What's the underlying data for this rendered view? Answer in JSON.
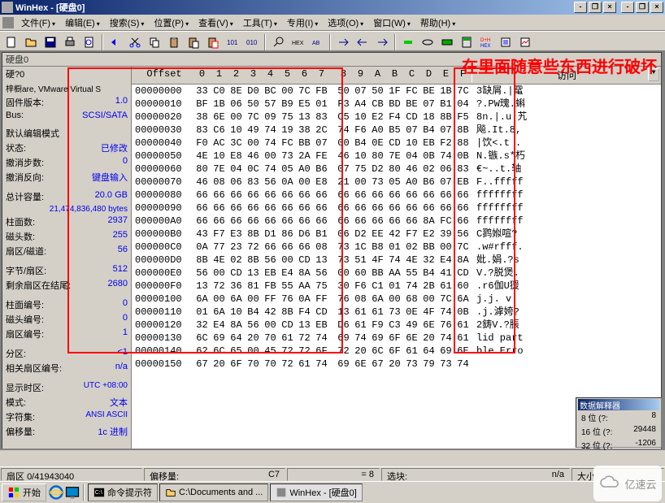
{
  "title": "WinHex - [硬盘0]",
  "menu": [
    "文件(F)",
    "编辑(E)",
    "搜索(S)",
    "位置(P)",
    "查看(V)",
    "工具(T)",
    "专用(I)",
    "选项(O)",
    "窗口(W)",
    "帮助(H)"
  ],
  "watermark": "在里面随意些东西进行破坏",
  "doc_title": "硬盘0",
  "sidebar": {
    "hardware": {
      "lbl": "硬?0",
      "val": ""
    },
    "model": {
      "lbl": "梓橱are, VMware Virtual S",
      "val": ""
    },
    "firmware": {
      "lbl": "固件版本:",
      "val": "1.0"
    },
    "bus": {
      "lbl": "Bus:",
      "val": "SCSI/SATA"
    },
    "edit_mode": {
      "lbl": "默认编辑模式",
      "val": ""
    },
    "status": {
      "lbl": "状态:",
      "val": "已修改"
    },
    "undo_steps": {
      "lbl": "撤消步数:",
      "val": "0"
    },
    "undo_dir": {
      "lbl": "撤消反向:",
      "val": "键盘输入"
    },
    "total": {
      "lbl": "总计容量:",
      "val": "20.0 GB"
    },
    "total_bytes": {
      "lbl": "",
      "val": "21,474,836,480 bytes"
    },
    "cylinders": {
      "lbl": "柱面数:",
      "val": "2937"
    },
    "heads": {
      "lbl": "磁头数:",
      "val": "255"
    },
    "sectors_track": {
      "lbl": "扇区/磁道:",
      "val": "56"
    },
    "bytes_sector": {
      "lbl": "字节/扇区:",
      "val": "512"
    },
    "remaining": {
      "lbl": "剩余扇区在结尾:",
      "val": "2680"
    },
    "col_no": {
      "lbl": "柱面编号:",
      "val": "0"
    },
    "head_no": {
      "lbl": "磁头编号:",
      "val": "0"
    },
    "sector_no": {
      "lbl": "扇区编号:",
      "val": "1"
    },
    "partition": {
      "lbl": "分区:",
      "val": "<1"
    },
    "rel_sector": {
      "lbl": "相关扇区编号:",
      "val": "n/a"
    },
    "timezone": {
      "lbl": "显示时区:",
      "val": "UTC +08:00"
    },
    "mode": {
      "lbl": "模式:",
      "val": "文本"
    },
    "charset": {
      "lbl": "字符集:",
      "val": "ANSI ASCII"
    },
    "last": {
      "lbl": "偏移量:",
      "val": "1c 进制"
    }
  },
  "hex": {
    "header_offset": "Offset",
    "header_bytes": [
      "0",
      "1",
      "2",
      "3",
      "4",
      "5",
      "6",
      "7",
      "8",
      "9",
      "A",
      "B",
      "C",
      "D",
      "E",
      "F"
    ],
    "header_ascii": "访问",
    "rows": [
      {
        "o": "00000000",
        "b": [
          "33",
          "C0",
          "8E",
          "D0",
          "BC",
          "00",
          "7C",
          "FB",
          "50",
          "07",
          "50",
          "1F",
          "FC",
          "BE",
          "1B",
          "7C"
        ],
        "a": "3缺屑.|鼋"
      },
      {
        "o": "00000010",
        "b": [
          "BF",
          "1B",
          "06",
          "50",
          "57",
          "B9",
          "E5",
          "01",
          "F3",
          "A4",
          "CB",
          "BD",
          "BE",
          "07",
          "B1",
          "04"
        ],
        "a": "?.PW瑰.蝌"
      },
      {
        "o": "00000020",
        "b": [
          "38",
          "6E",
          "00",
          "7C",
          "09",
          "75",
          "13",
          "83",
          "C5",
          "10",
          "E2",
          "F4",
          "CD",
          "18",
          "8B",
          "F5"
        ],
        "a": "8n.|.u.艽"
      },
      {
        "o": "00000030",
        "b": [
          "83",
          "C6",
          "10",
          "49",
          "74",
          "19",
          "38",
          "2C",
          "74",
          "F6",
          "A0",
          "B5",
          "07",
          "B4",
          "07",
          "8B"
        ],
        "a": "飚.It.8,"
      },
      {
        "o": "00000040",
        "b": [
          "F0",
          "AC",
          "3C",
          "00",
          "74",
          "FC",
          "BB",
          "07",
          "00",
          "B4",
          "0E",
          "CD",
          "10",
          "EB",
          "F2",
          "88"
        ],
        "a": "|饮<.t   ."
      },
      {
        "o": "00000050",
        "b": [
          "4E",
          "10",
          "E8",
          "46",
          "00",
          "73",
          "2A",
          "FE",
          "46",
          "10",
          "80",
          "7E",
          "04",
          "0B",
          "74",
          "0B"
        ],
        "a": "N.镞.s*朽"
      },
      {
        "o": "00000060",
        "b": [
          "80",
          "7E",
          "04",
          "0C",
          "74",
          "05",
          "A0",
          "B6",
          "07",
          "75",
          "D2",
          "80",
          "46",
          "02",
          "06",
          "83"
        ],
        "a": "€~..t.轴"
      },
      {
        "o": "00000070",
        "b": [
          "46",
          "08",
          "06",
          "83",
          "56",
          "0A",
          "00",
          "E8",
          "21",
          "00",
          "73",
          "05",
          "A0",
          "B6",
          "07",
          "EB"
        ],
        "a": "F..fffff"
      },
      {
        "o": "00000080",
        "b": [
          "66",
          "66",
          "66",
          "66",
          "66",
          "66",
          "66",
          "66",
          "66",
          "66",
          "66",
          "66",
          "66",
          "66",
          "66",
          "66"
        ],
        "a": "ffffffff"
      },
      {
        "o": "00000090",
        "b": [
          "66",
          "66",
          "66",
          "66",
          "66",
          "66",
          "66",
          "66",
          "66",
          "66",
          "66",
          "66",
          "66",
          "66",
          "66",
          "66"
        ],
        "a": "ffffffff"
      },
      {
        "o": "000000A0",
        "b": [
          "66",
          "66",
          "66",
          "66",
          "66",
          "66",
          "66",
          "66",
          "66",
          "66",
          "66",
          "66",
          "66",
          "8A",
          "FC",
          "66"
        ],
        "a": "ffffffff"
      },
      {
        "o": "000000B0",
        "b": [
          "43",
          "F7",
          "E3",
          "8B",
          "D1",
          "86",
          "D6",
          "B1",
          "06",
          "D2",
          "EE",
          "42",
          "F7",
          "E2",
          "39",
          "56"
        ],
        "a": "C鹨娰喧?"
      },
      {
        "o": "000000C0",
        "b": [
          "0A",
          "77",
          "23",
          "72",
          "66",
          "66",
          "66",
          "08",
          "73",
          "1C",
          "B8",
          "01",
          "02",
          "BB",
          "00",
          "7C"
        ],
        "a": ".w#rfff."
      },
      {
        "o": "000000D0",
        "b": [
          "8B",
          "4E",
          "02",
          "8B",
          "56",
          "00",
          "CD",
          "13",
          "73",
          "51",
          "4F",
          "74",
          "4E",
          "32",
          "E4",
          "8A"
        ],
        "a": "妣.娟.?s"
      },
      {
        "o": "000000E0",
        "b": [
          "56",
          "00",
          "CD",
          "13",
          "EB",
          "E4",
          "8A",
          "56",
          "00",
          "60",
          "BB",
          "AA",
          "55",
          "B4",
          "41",
          "CD"
        ],
        "a": "V.?脱煲."
      },
      {
        "o": "000000F0",
        "b": [
          "13",
          "72",
          "36",
          "81",
          "FB",
          "55",
          "AA",
          "75",
          "30",
          "F6",
          "C1",
          "01",
          "74",
          "2B",
          "61",
          "60"
        ],
        "a": ".r6伽U猨"
      },
      {
        "o": "00000100",
        "b": [
          "6A",
          "00",
          "6A",
          "00",
          "FF",
          "76",
          "0A",
          "FF",
          "76",
          "08",
          "6A",
          "00",
          "68",
          "00",
          "7C",
          "6A"
        ],
        "a": "j.j.  v."
      },
      {
        "o": "00000110",
        "b": [
          "01",
          "6A",
          "10",
          "B4",
          "42",
          "8B",
          "F4",
          "CD",
          "13",
          "61",
          "61",
          "73",
          "0E",
          "4F",
          "74",
          "0B"
        ],
        "a": ".j.滹姱?"
      },
      {
        "o": "00000120",
        "b": [
          "32",
          "E4",
          "8A",
          "56",
          "00",
          "CD",
          "13",
          "EB",
          "D6",
          "61",
          "F9",
          "C3",
          "49",
          "6E",
          "76",
          "61"
        ],
        "a": "2鋳V.?脹"
      },
      {
        "o": "00000130",
        "b": [
          "6C",
          "69",
          "64",
          "20",
          "70",
          "61",
          "72",
          "74",
          "69",
          "74",
          "69",
          "6F",
          "6E",
          "20",
          "74",
          "61"
        ],
        "a": "lid part"
      },
      {
        "o": "00000140",
        "b": [
          "62",
          "6C",
          "65",
          "00",
          "45",
          "72",
          "72",
          "6F",
          "72",
          "20",
          "6C",
          "6F",
          "61",
          "64",
          "69",
          "6E"
        ],
        "a": "ble Erro"
      },
      {
        "o": "00000150",
        "b": [
          "67",
          "20",
          "6F",
          "70",
          "70",
          "72",
          "61",
          "74",
          "69",
          "6E",
          "67",
          "20",
          "73",
          "79",
          "73",
          "74"
        ],
        "a": ""
      }
    ]
  },
  "status": {
    "sector": {
      "lbl": "扇区",
      "val": "0/41943040"
    },
    "offset": {
      "lbl": "偏移量:",
      "val": "C7"
    },
    "eq": {
      "lbl": "= 8",
      "val": ""
    },
    "sel": {
      "lbl": "选块:",
      "val": "n/a"
    },
    "size": {
      "lbl": "大小:",
      "val": ""
    }
  },
  "interpreter": {
    "title": "数据解释器",
    "r1": {
      "lbl": "8 位 (?:",
      "val": "8"
    },
    "r2": {
      "lbl": "16 位 (?:",
      "val": "29448"
    },
    "r3": {
      "lbl": "32 位 (?:",
      "val": "-1206"
    }
  },
  "taskbar": {
    "start": "开始",
    "t1": "命令提示符",
    "t2": "C:\\Documents and ...",
    "t3": "WinHex - [硬盘0]"
  },
  "yisu": "亿速云"
}
